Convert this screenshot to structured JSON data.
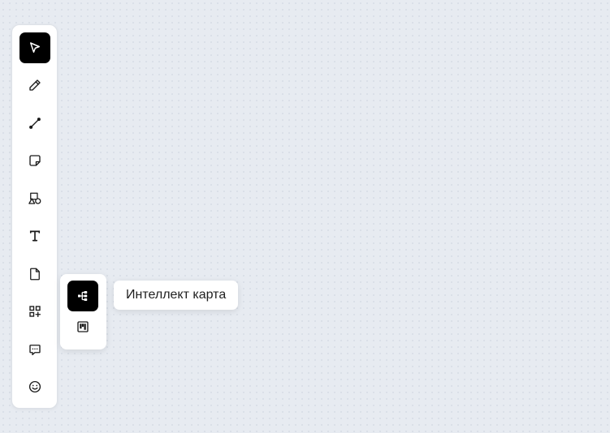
{
  "canvas": {
    "background_color": "#e7ebf1",
    "dot_color": "#cfd5df"
  },
  "toolbar": {
    "active_color": "#000000",
    "tools": [
      {
        "icon": "cursor-icon",
        "active": true
      },
      {
        "icon": "pencil-icon",
        "active": false
      },
      {
        "icon": "connector-line-icon",
        "active": false
      },
      {
        "icon": "sticky-note-icon",
        "active": false
      },
      {
        "icon": "shapes-icon",
        "active": false
      },
      {
        "icon": "text-icon",
        "active": false
      },
      {
        "icon": "document-icon",
        "active": false
      },
      {
        "icon": "add-widget-icon",
        "active": false
      },
      {
        "icon": "comment-icon",
        "active": false
      },
      {
        "icon": "emoji-icon",
        "active": false
      }
    ]
  },
  "flyout": {
    "items": [
      {
        "icon": "mind-map-icon",
        "active": true
      },
      {
        "icon": "kanban-board-icon",
        "active": false
      }
    ]
  },
  "tooltip": {
    "text": "Интеллект карта"
  }
}
